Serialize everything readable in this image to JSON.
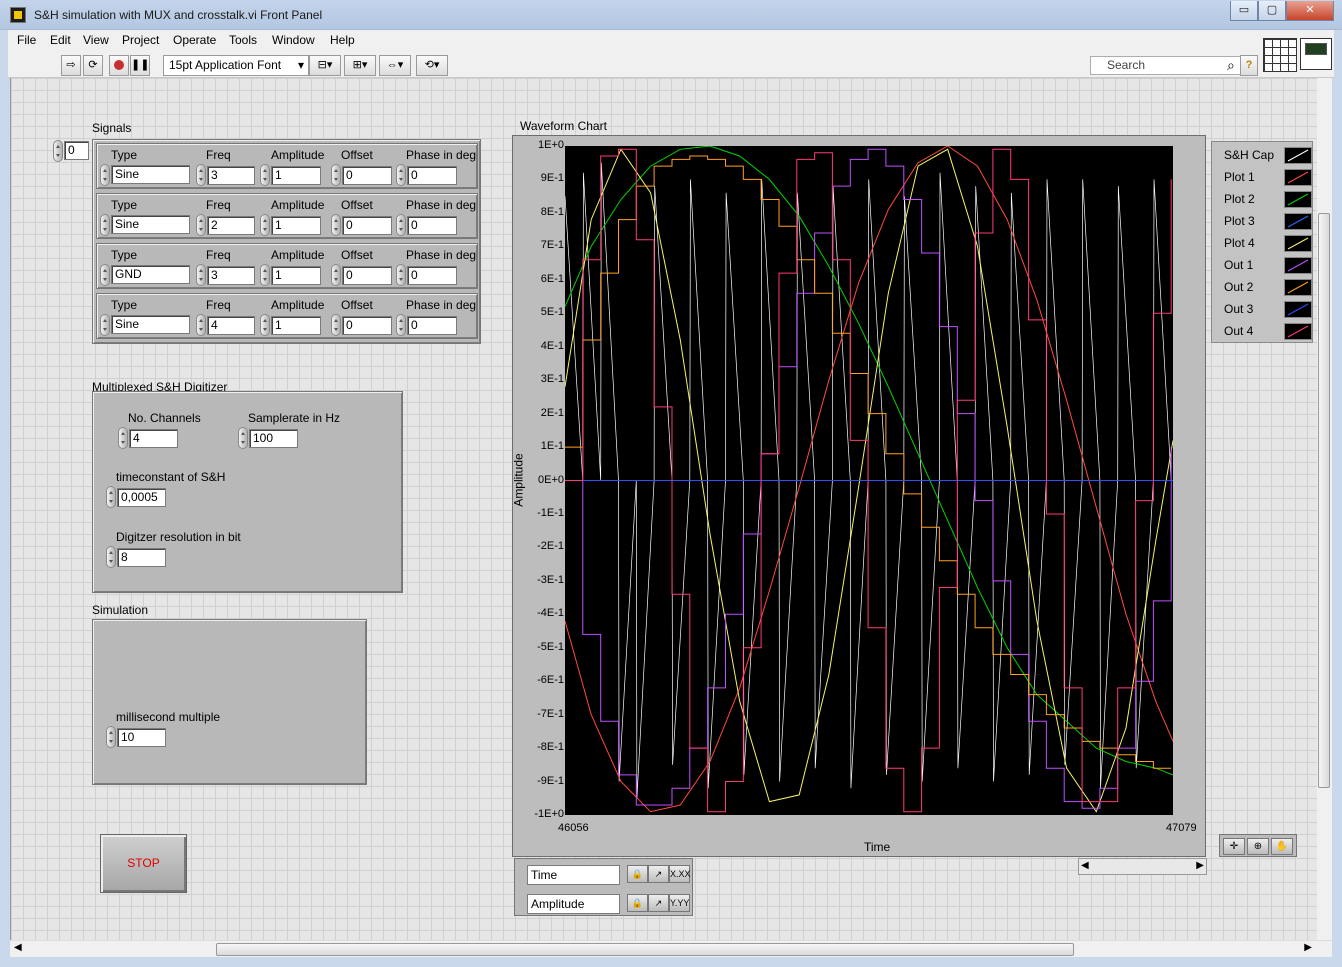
{
  "window": {
    "title": "S&H simulation with MUX and crosstalk.vi Front Panel",
    "minimize_label": "▭",
    "restore_label": "▢",
    "close_label": "✕"
  },
  "menu": [
    "File",
    "Edit",
    "View",
    "Project",
    "Operate",
    "Tools",
    "Window",
    "Help"
  ],
  "toolbar": {
    "font": "15pt Application Font",
    "search_placeholder": "Search",
    "help_label": "?"
  },
  "signals": {
    "label": "Signals",
    "index": "0",
    "headers": {
      "type": "Type",
      "freq": "Freq",
      "amplitude": "Amplitude",
      "offset": "Offset",
      "phase": "Phase in deg"
    },
    "rows": [
      {
        "type": "Sine",
        "freq": "3",
        "amplitude": "1",
        "offset": "0",
        "phase": "0"
      },
      {
        "type": "Sine",
        "freq": "2",
        "amplitude": "1",
        "offset": "0",
        "phase": "0"
      },
      {
        "type": "GND",
        "freq": "3",
        "amplitude": "1",
        "offset": "0",
        "phase": "0"
      },
      {
        "type": "Sine",
        "freq": "4",
        "amplitude": "1",
        "offset": "0",
        "phase": "0"
      }
    ]
  },
  "digitizer": {
    "label": "Multiplexed S&H Digitizer",
    "channels_label": "No. Channels",
    "channels": "4",
    "samplerate_label": "Samplerate in Hz",
    "samplerate": "100",
    "timeconstant_label": "timeconstant of S&H",
    "timeconstant": "0,0005",
    "resolution_label": "Digitzer resolution in bit",
    "resolution": "8"
  },
  "simulation": {
    "label": "Simulation",
    "ms_label": "millisecond multiple",
    "ms": "10"
  },
  "stop_label": "STOP",
  "chart_data": {
    "type": "line",
    "title": "Waveform Chart",
    "xlabel": "Time",
    "ylabel": "Amplitude",
    "xlim": [
      46056,
      47079
    ],
    "ylim": [
      -1,
      1
    ],
    "x_ticks": [
      "46056",
      "47079"
    ],
    "y_ticks": [
      "1E+0",
      "9E-1",
      "8E-1",
      "7E-1",
      "6E-1",
      "5E-1",
      "4E-1",
      "3E-1",
      "2E-1",
      "1E-1",
      "0E+0",
      "-1E-1",
      "-2E-1",
      "-3E-1",
      "-4E-1",
      "-5E-1",
      "-6E-1",
      "-7E-1",
      "-8E-1",
      "-9E-1",
      "-1E+0"
    ],
    "grid": false,
    "legend": "right",
    "series": [
      {
        "name": "S&H Cap",
        "color": "#ffffff",
        "style": "sawtooth",
        "x": [
          46056,
          46086,
          46087,
          46116,
          46117,
          46146,
          46147,
          46176,
          46177,
          46206,
          46207,
          46236,
          46237,
          46266,
          46267,
          46296,
          46297,
          46326,
          46327,
          46356,
          46357,
          46386,
          46387,
          46416,
          46417,
          46446,
          46447,
          46476,
          46477,
          46506,
          46507,
          46536,
          46537,
          46566,
          46567,
          46596,
          46597,
          46626,
          46627,
          46656,
          46657,
          46686,
          46687,
          46716,
          46717,
          46746,
          46747,
          46776,
          46777,
          46806,
          46807,
          46836,
          46837,
          46866,
          46867,
          46896,
          46897,
          46926,
          46927,
          46956,
          46957,
          46986,
          46987,
          47016,
          47017,
          47046,
          47047,
          47076
        ],
        "y": [
          0.85,
          0.0,
          0.92,
          0.0,
          0.95,
          0.0,
          -0.9,
          0.0,
          -0.95,
          0.0,
          0.88,
          0.0,
          -0.85,
          0.0,
          0.9,
          0.0,
          -0.92,
          0.0,
          0.86,
          0.0,
          -0.88,
          0.0,
          0.9,
          0.0,
          -0.9,
          0.0,
          0.86,
          0.0,
          -0.86,
          0.0,
          0.88,
          0.0,
          -0.92,
          0.0,
          0.9,
          0.0,
          -0.88,
          0.0,
          0.85,
          0.0,
          -0.9,
          0.0,
          0.92,
          0.0,
          -0.86,
          0.0,
          0.88,
          0.0,
          -0.9,
          0.0,
          0.86,
          0.0,
          -0.88,
          0.0,
          0.9,
          0.0,
          -0.85,
          0.0,
          0.9,
          0.0,
          -0.92,
          0.0,
          0.88,
          0.0,
          -0.86,
          0.0,
          0.9,
          0.0
        ]
      },
      {
        "name": "Plot 1",
        "color": "#ff4a3a",
        "x": [
          46056,
          46100,
          46150,
          46200,
          46250,
          46300,
          46350,
          46400,
          46450,
          46500,
          46550,
          46600,
          46650,
          46700,
          46750,
          46800,
          46850,
          46900,
          46950,
          47000,
          47050,
          47079
        ],
        "y": [
          -0.42,
          -0.7,
          -0.9,
          -0.99,
          -0.97,
          -0.84,
          -0.62,
          -0.33,
          -0.02,
          0.3,
          0.59,
          0.81,
          0.95,
          1.0,
          0.94,
          0.78,
          0.54,
          0.24,
          -0.08,
          -0.4,
          -0.66,
          -0.78
        ]
      },
      {
        "name": "Plot 2",
        "color": "#00d400",
        "x": [
          46056,
          46100,
          46150,
          46200,
          46250,
          46300,
          46350,
          46400,
          46450,
          46500,
          46550,
          46600,
          46650,
          46700,
          46750,
          46800,
          46850,
          46900,
          46950,
          47000,
          47050,
          47079
        ],
        "y": [
          0.52,
          0.7,
          0.84,
          0.94,
          0.99,
          1.0,
          0.97,
          0.9,
          0.79,
          0.64,
          0.47,
          0.28,
          0.08,
          -0.12,
          -0.32,
          -0.5,
          -0.64,
          -0.72,
          -0.8,
          -0.84,
          -0.86,
          -0.88
        ]
      },
      {
        "name": "Plot 3",
        "color": "#2b6bff",
        "x": [
          46056,
          47079
        ],
        "y": [
          0.0,
          0.0
        ]
      },
      {
        "name": "Plot 4",
        "color": "#f4f46a",
        "x": [
          46056,
          46100,
          46150,
          46200,
          46250,
          46300,
          46350,
          46400,
          46450,
          46500,
          46550,
          46600,
          46650,
          46700,
          46750,
          46800,
          46850,
          46900,
          46950,
          47000,
          47050,
          47079
        ],
        "y": [
          0.28,
          0.78,
          0.99,
          0.86,
          0.42,
          -0.16,
          -0.66,
          -0.96,
          -0.94,
          -0.58,
          -0.02,
          0.56,
          0.94,
          0.99,
          0.7,
          0.16,
          -0.42,
          -0.86,
          -0.99,
          -0.74,
          -0.18,
          0.12
        ]
      },
      {
        "name": "Out 1",
        "color": "#c050ff",
        "style": "step",
        "x": [
          46056,
          46086,
          46116,
          46146,
          46176,
          46206,
          46236,
          46266,
          46296,
          46326,
          46356,
          46386,
          46416,
          46446,
          46476,
          46506,
          46536,
          46566,
          46596,
          46626,
          46656,
          46686,
          46716,
          46746,
          46776,
          46806,
          46836,
          46866,
          46896,
          46926,
          46956,
          46986,
          47016,
          47046,
          47076
        ],
        "y": [
          0.0,
          -0.46,
          -0.72,
          -0.88,
          -0.97,
          -0.97,
          -0.92,
          -0.8,
          -0.62,
          -0.4,
          -0.16,
          0.08,
          0.34,
          0.56,
          0.74,
          0.88,
          0.96,
          0.99,
          0.94,
          0.84,
          0.68,
          0.46,
          0.2,
          -0.06,
          -0.3,
          -0.52,
          -0.72,
          -0.86,
          -0.96,
          -0.98,
          -0.92,
          -0.8,
          -0.6,
          -0.36,
          0.1
        ]
      },
      {
        "name": "Out 2",
        "color": "#ffa020",
        "style": "step",
        "x": [
          46056,
          46086,
          46116,
          46146,
          46176,
          46206,
          46236,
          46266,
          46296,
          46326,
          46356,
          46386,
          46416,
          46446,
          46476,
          46506,
          46536,
          46566,
          46596,
          46626,
          46656,
          46686,
          46716,
          46746,
          46776,
          46806,
          46836,
          46866,
          46896,
          46926,
          46956,
          46986,
          47016,
          47046,
          47076
        ],
        "y": [
          0.1,
          0.42,
          0.62,
          0.78,
          0.88,
          0.94,
          0.96,
          0.97,
          0.96,
          0.94,
          0.9,
          0.84,
          0.76,
          0.66,
          0.56,
          0.44,
          0.32,
          0.2,
          0.08,
          -0.04,
          -0.14,
          -0.24,
          -0.34,
          -0.44,
          -0.52,
          -0.58,
          -0.64,
          -0.7,
          -0.74,
          -0.78,
          -0.8,
          -0.82,
          -0.84,
          -0.86,
          -0.86
        ]
      },
      {
        "name": "Out 3",
        "color": "#3050ff",
        "style": "step",
        "x": [
          46056,
          47079
        ],
        "y": [
          0.0,
          0.0
        ]
      },
      {
        "name": "Out 4",
        "color": "#ff3a7a",
        "style": "step",
        "x": [
          46056,
          46086,
          46116,
          46146,
          46176,
          46206,
          46236,
          46266,
          46296,
          46326,
          46356,
          46386,
          46416,
          46446,
          46476,
          46506,
          46536,
          46566,
          46596,
          46626,
          46656,
          46686,
          46716,
          46746,
          46776,
          46806,
          46836,
          46866,
          46896,
          46926,
          46956,
          46986,
          47016,
          47046,
          47076
        ],
        "y": [
          0.0,
          0.66,
          0.97,
          0.99,
          0.72,
          0.22,
          -0.34,
          -0.8,
          -0.99,
          -0.9,
          -0.5,
          0.08,
          0.62,
          0.96,
          0.98,
          0.66,
          0.12,
          -0.44,
          -0.86,
          -0.99,
          -0.8,
          -0.32,
          0.24,
          0.74,
          0.99,
          0.9,
          0.48,
          -0.1,
          -0.62,
          -0.96,
          -0.96,
          -0.62,
          -0.06,
          0.5,
          0.9
        ]
      }
    ]
  },
  "scale_legend": {
    "x_name": "Time",
    "y_name": "Amplitude",
    "lock_label": "🔒",
    "x_fmt": "X.XX",
    "y_fmt": "Y.YY"
  },
  "palette": {
    "cursor": "✛",
    "zoom": "⊕",
    "pan": "✋"
  }
}
